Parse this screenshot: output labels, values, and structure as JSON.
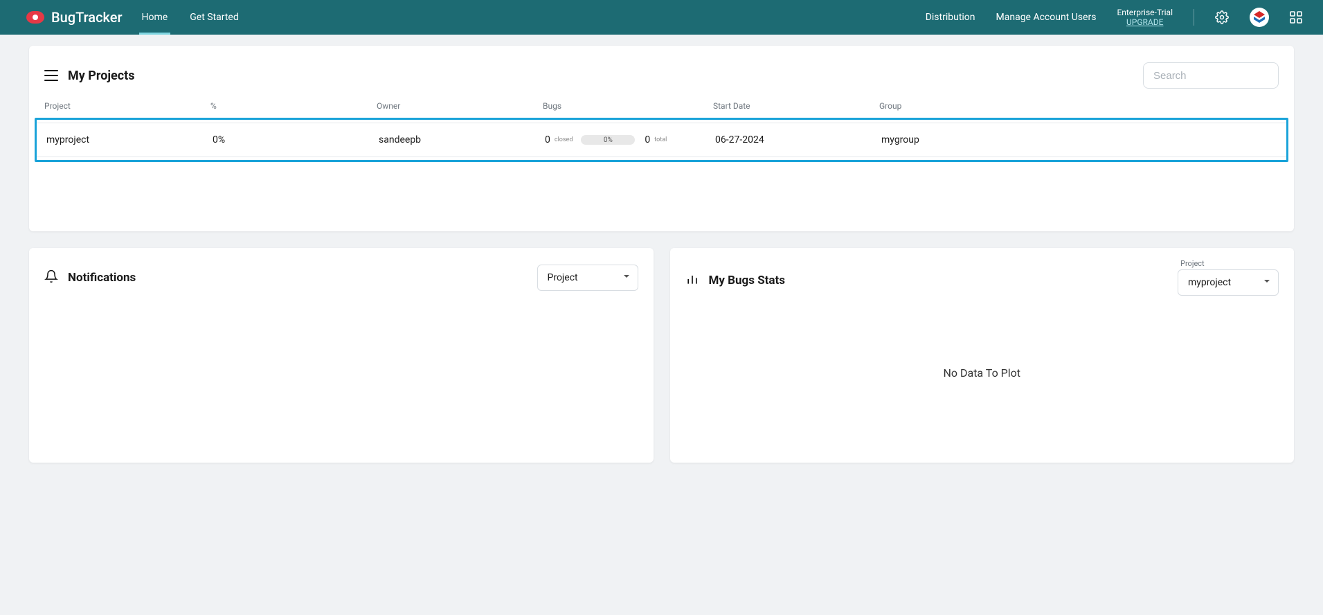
{
  "nav": {
    "app_title": "BugTracker",
    "links": [
      "Home",
      "Get Started"
    ],
    "right_links": [
      "Distribution",
      "Manage Account Users"
    ],
    "trial_label": "Enterprise-Trial",
    "upgrade_label": "UPGRADE"
  },
  "projects": {
    "title": "My Projects",
    "search_placeholder": "Search",
    "columns": {
      "project": "Project",
      "percent": "%",
      "owner": "Owner",
      "bugs": "Bugs",
      "start_date": "Start Date",
      "group": "Group"
    },
    "rows": [
      {
        "project": "myproject",
        "percent": "0%",
        "owner": "sandeepb",
        "bugs_closed": "0",
        "bugs_closed_label": "closed",
        "bugs_bar": "0%",
        "bugs_total": "0",
        "bugs_total_label": "total",
        "start_date": "06-27-2024",
        "group": "mygroup"
      }
    ]
  },
  "notifications": {
    "title": "Notifications",
    "select_value": "Project"
  },
  "stats": {
    "title": "My Bugs Stats",
    "select_label": "Project",
    "select_value": "myproject",
    "empty_message": "No Data To Plot"
  }
}
